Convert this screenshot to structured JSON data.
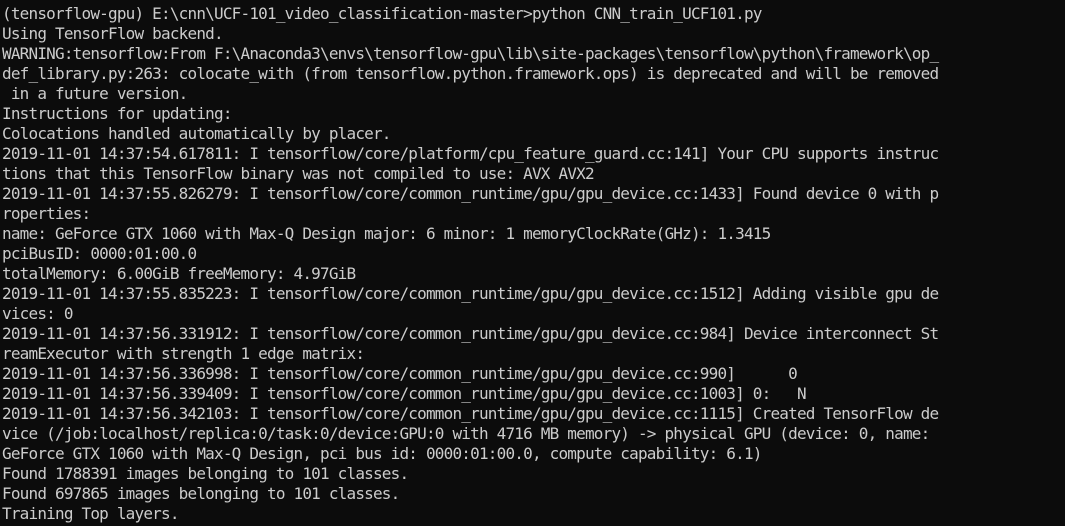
{
  "terminal": {
    "background_color": "#0c0c0c",
    "text_color": "#cccccc",
    "lines": [
      "(tensorflow-gpu) E:\\cnn\\UCF-101_video_classification-master>python CNN_train_UCF101.py",
      "Using TensorFlow backend.",
      "WARNING:tensorflow:From F:\\Anaconda3\\envs\\tensorflow-gpu\\lib\\site-packages\\tensorflow\\python\\framework\\op_",
      "def_library.py:263: colocate_with (from tensorflow.python.framework.ops) is deprecated and will be removed",
      " in a future version.",
      "Instructions for updating:",
      "Colocations handled automatically by placer.",
      "2019-11-01 14:37:54.617811: I tensorflow/core/platform/cpu_feature_guard.cc:141] Your CPU supports instruc",
      "tions that this TensorFlow binary was not compiled to use: AVX AVX2",
      "2019-11-01 14:37:55.826279: I tensorflow/core/common_runtime/gpu/gpu_device.cc:1433] Found device 0 with p",
      "roperties:",
      "name: GeForce GTX 1060 with Max-Q Design major: 6 minor: 1 memoryClockRate(GHz): 1.3415",
      "pciBusID: 0000:01:00.0",
      "totalMemory: 6.00GiB freeMemory: 4.97GiB",
      "2019-11-01 14:37:55.835223: I tensorflow/core/common_runtime/gpu/gpu_device.cc:1512] Adding visible gpu de",
      "vices: 0",
      "2019-11-01 14:37:56.331912: I tensorflow/core/common_runtime/gpu/gpu_device.cc:984] Device interconnect St",
      "reamExecutor with strength 1 edge matrix:",
      "2019-11-01 14:37:56.336998: I tensorflow/core/common_runtime/gpu/gpu_device.cc:990]      0",
      "2019-11-01 14:37:56.339409: I tensorflow/core/common_runtime/gpu/gpu_device.cc:1003] 0:   N",
      "2019-11-01 14:37:56.342103: I tensorflow/core/common_runtime/gpu/gpu_device.cc:1115] Created TensorFlow de",
      "vice (/job:localhost/replica:0/task:0/device:GPU:0 with 4716 MB memory) -> physical GPU (device: 0, name:",
      "GeForce GTX 1060 with Max-Q Design, pci bus id: 0000:01:00.0, compute capability: 6.1)",
      "Found 1788391 images belonging to 101 classes.",
      "Found 697865 images belonging to 101 classes.",
      "Training Top layers."
    ]
  }
}
